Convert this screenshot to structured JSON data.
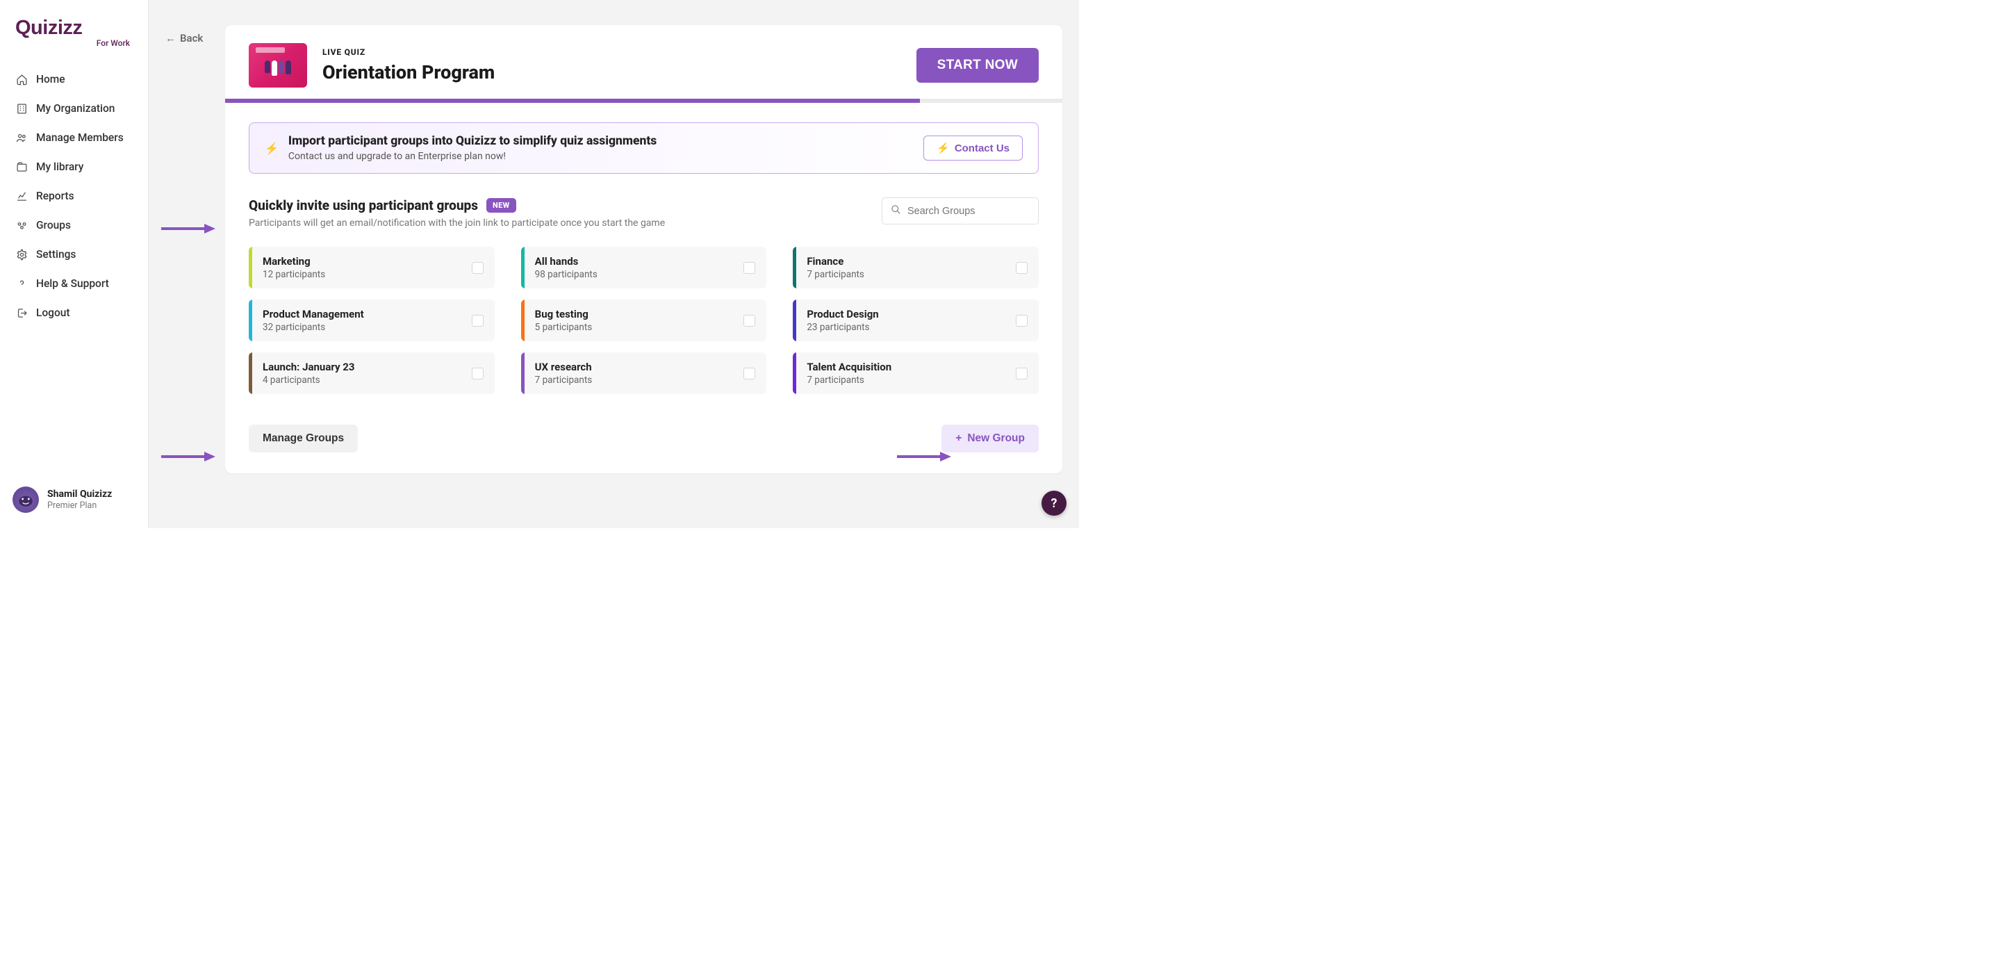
{
  "brand": {
    "name": "Quizizz",
    "subline": "For Work"
  },
  "sidebar": {
    "items": [
      {
        "icon": "home-icon",
        "label": "Home"
      },
      {
        "icon": "building-icon",
        "label": "My Organization"
      },
      {
        "icon": "members-icon",
        "label": "Manage Members"
      },
      {
        "icon": "library-icon",
        "label": "My library"
      },
      {
        "icon": "reports-icon",
        "label": "Reports"
      },
      {
        "icon": "groups-icon",
        "label": "Groups"
      },
      {
        "icon": "settings-icon",
        "label": "Settings"
      },
      {
        "icon": "help-icon",
        "label": "Help & Support"
      },
      {
        "icon": "logout-icon",
        "label": "Logout"
      }
    ]
  },
  "user": {
    "name": "Shamil Quizizz",
    "plan": "Premier Plan"
  },
  "back_label": "Back",
  "header": {
    "kicker": "LIVE QUIZ",
    "title": "Orientation Program",
    "start_label": "START NOW",
    "progress_percent": 83
  },
  "promo": {
    "title": "Import participant groups into Quizizz to simplify quiz assignments",
    "sub": "Contact us and upgrade to an Enterprise plan now!",
    "cta": "Contact Us"
  },
  "section": {
    "title": "Quickly invite using participant groups",
    "badge": "NEW",
    "sub": "Participants will get an email/notification with the join link to participate once you start the game",
    "search_placeholder": "Search Groups"
  },
  "groups": [
    {
      "name": "Marketing",
      "participants": "12 participants",
      "color": "#c4d92e"
    },
    {
      "name": "All hands",
      "participants": "98 participants",
      "color": "#14b8a6"
    },
    {
      "name": "Finance",
      "participants": "7 participants",
      "color": "#0f766e"
    },
    {
      "name": "Product Management",
      "participants": "32 participants",
      "color": "#22b5d9"
    },
    {
      "name": "Bug testing",
      "participants": "5 participants",
      "color": "#f97316"
    },
    {
      "name": "Product Design",
      "participants": "23 participants",
      "color": "#4338ca"
    },
    {
      "name": "Launch: January 23",
      "participants": "4 participants",
      "color": "#7c5a3a"
    },
    {
      "name": "UX research",
      "participants": "7 participants",
      "color": "#8854c0"
    },
    {
      "name": "Talent Acquisition",
      "participants": "7 participants",
      "color": "#6d28d9"
    }
  ],
  "footer": {
    "manage_label": "Manage Groups",
    "new_group_label": "New Group"
  }
}
